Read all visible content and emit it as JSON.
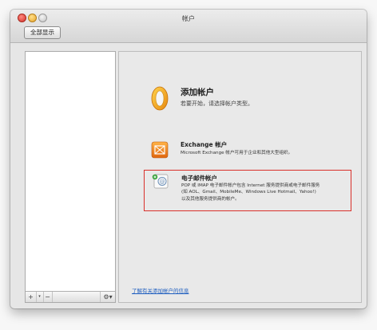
{
  "window": {
    "title": "帐户",
    "show_all_button": "全部显示"
  },
  "sidebar": {
    "add_button": "+",
    "add_menu": "▾",
    "remove_button": "−",
    "gear_button": "⚙▾"
  },
  "main": {
    "add_account": {
      "title": "添加帐户",
      "subtitle": "若要开始，请选择帐户类型。",
      "icon": "outlook-icon"
    },
    "options": [
      {
        "title": "Exchange 帐户",
        "desc_lines": [
          "Microsoft Exchange 帐户可用于企业和其他大型组织。"
        ],
        "icon": "exchange-icon"
      },
      {
        "title": "电子邮件帐户",
        "desc_lines": [
          "POP 或 IMAP 电子邮件帐户包含 Internet 服务提供商或电子邮件服务",
          "(如 AOL、Gmail、MobileMe、Windows Live Hotmail、Yahoo!)",
          "以及其他服务提供商的帐户。"
        ],
        "icon": "email-account-icon",
        "highlighted": true,
        "highlight_color": "#d9302a"
      }
    ],
    "learn_more_link": "了解有关添加帐户的信息"
  }
}
